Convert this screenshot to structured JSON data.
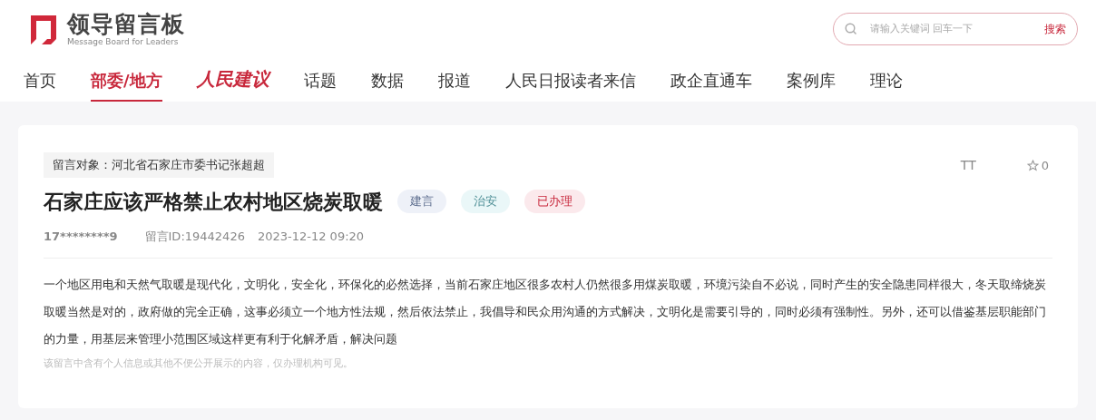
{
  "logo": {
    "title": "领导留言板",
    "subtitle": "Message Board for Leaders"
  },
  "search": {
    "placeholder": "请输入关键词 回车一下",
    "button": "搜索"
  },
  "nav": [
    {
      "label": "首页",
      "kind": "text",
      "selected": false
    },
    {
      "label": "部委/地方",
      "kind": "text",
      "selected": true
    },
    {
      "label": "人民建议",
      "kind": "brand",
      "selected": false
    },
    {
      "label": "话题",
      "kind": "text",
      "selected": false
    },
    {
      "label": "数据",
      "kind": "text",
      "selected": false
    },
    {
      "label": "报道",
      "kind": "text",
      "selected": false
    },
    {
      "label": "人民日报读者来信",
      "kind": "text",
      "selected": false
    },
    {
      "label": "政企直通车",
      "kind": "text",
      "selected": false
    },
    {
      "label": "案例库",
      "kind": "text",
      "selected": false
    },
    {
      "label": "理论",
      "kind": "text",
      "selected": false
    }
  ],
  "message": {
    "target": "留言对象：河北省石家庄市委书记张超超",
    "font_button": "TT",
    "favorites": "0",
    "title": "石家庄应该严格禁止农村地区烧炭取暖",
    "tags": [
      {
        "label": "建言",
        "color": "#eef1f8"
      },
      {
        "label": "治安",
        "color": "#eaf7f8"
      },
      {
        "label": "已办理",
        "color": "#fbe9ec"
      }
    ],
    "author": "17********9",
    "id": "留言ID:19442426",
    "time": "2023-12-12 09:20",
    "body": "一个地区用电和天然气取暖是现代化，文明化，安全化，环保化的必然选择，当前石家庄地区很多农村人仍然很多用煤炭取暖，环境污染自不必说，同时产生的安全隐患同样很大，冬天取缔烧炭取暖当然是对的，政府做的完全正确，这事必须立一个地方性法规，然后依法禁止，我倡导和民众用沟通的方式解决，文明化是需要引导的，同时必须有强制性。另外，还可以借鉴基层职能部门的力量，用基层来管理小范围区域这样更有利于化解矛盾，解决问题",
    "notice": "该留言中含有个人信息或其他不便公开展示的内容，仅办理机构可见。"
  }
}
